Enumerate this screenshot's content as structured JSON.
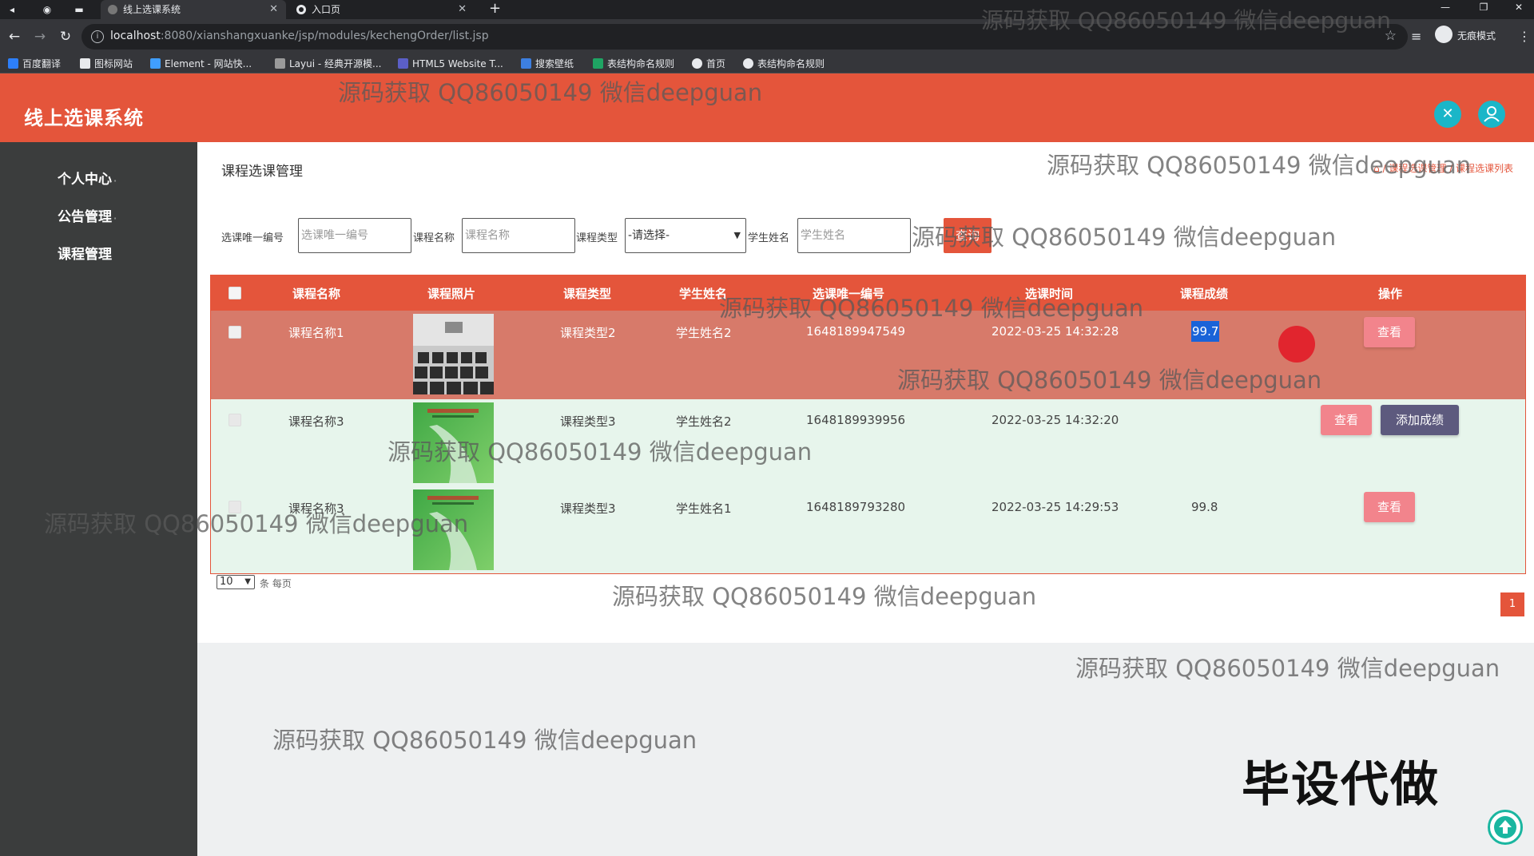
{
  "browser": {
    "tabs": [
      {
        "title": "线上选课系统",
        "active": true
      },
      {
        "title": "入口页",
        "active": false
      }
    ],
    "url_host": "localhost",
    "url_path": ":8080/xianshangxuanke/jsp/modules/kechengOrder/list.jsp",
    "incognito_label": "无痕模式",
    "bookmarks": [
      "百度翻译",
      "图标网站",
      "Element - 网站快...",
      "Layui - 经典开源模...",
      "HTML5 Website T...",
      "搜索壁纸",
      "表结构命名规则",
      "首页",
      "表结构命名规则"
    ]
  },
  "app": {
    "title": "线上选课系统",
    "sidebar": [
      "个人中心",
      "公告管理",
      "课程管理"
    ],
    "page_heading": "课程选课管理",
    "breadcrumb": "⌂ / 课程选课管理 / 课程选课列表"
  },
  "search": {
    "fields": [
      {
        "label": "选课唯一编号",
        "placeholder": "选课唯一编号"
      },
      {
        "label": "课程名称",
        "placeholder": "课程名称"
      },
      {
        "label": "课程类型",
        "value": "-请选择-"
      },
      {
        "label": "学生姓名",
        "placeholder": "学生姓名"
      }
    ],
    "button": "查询"
  },
  "table": {
    "headers": [
      "课程名称",
      "课程照片",
      "课程类型",
      "学生姓名",
      "选课唯一编号",
      "选课时间",
      "课程成绩",
      "操作"
    ],
    "rows": [
      {
        "name": "课程名称1",
        "type": "课程类型2",
        "student": "学生姓名2",
        "number": "1648189947549",
        "time": "2022-03-25 14:32:28",
        "score": "99.7",
        "actions": [
          "查看"
        ]
      },
      {
        "name": "课程名称3",
        "type": "课程类型3",
        "student": "学生姓名2",
        "number": "1648189939956",
        "time": "2022-03-25 14:32:20",
        "score": "",
        "actions": [
          "查看",
          "添加成绩"
        ]
      },
      {
        "name": "课程名称3",
        "type": "课程类型3",
        "student": "学生姓名1",
        "number": "1648189793280",
        "time": "2022-03-25 14:29:53",
        "score": "99.8",
        "actions": [
          "查看"
        ]
      }
    ]
  },
  "pagination": {
    "page_size": "10",
    "page_size_label": "条 每页",
    "current_page": "1"
  },
  "overlay": {
    "watermark": "源码获取 QQ86050149 微信deepguan",
    "big_text": "毕设代做"
  },
  "colors": {
    "accent": "#e4553b",
    "sidebar": "#3b3d3d",
    "teal": "#1ab6c8",
    "view_button": "#f2848c",
    "add_button": "#5d5a7e"
  }
}
